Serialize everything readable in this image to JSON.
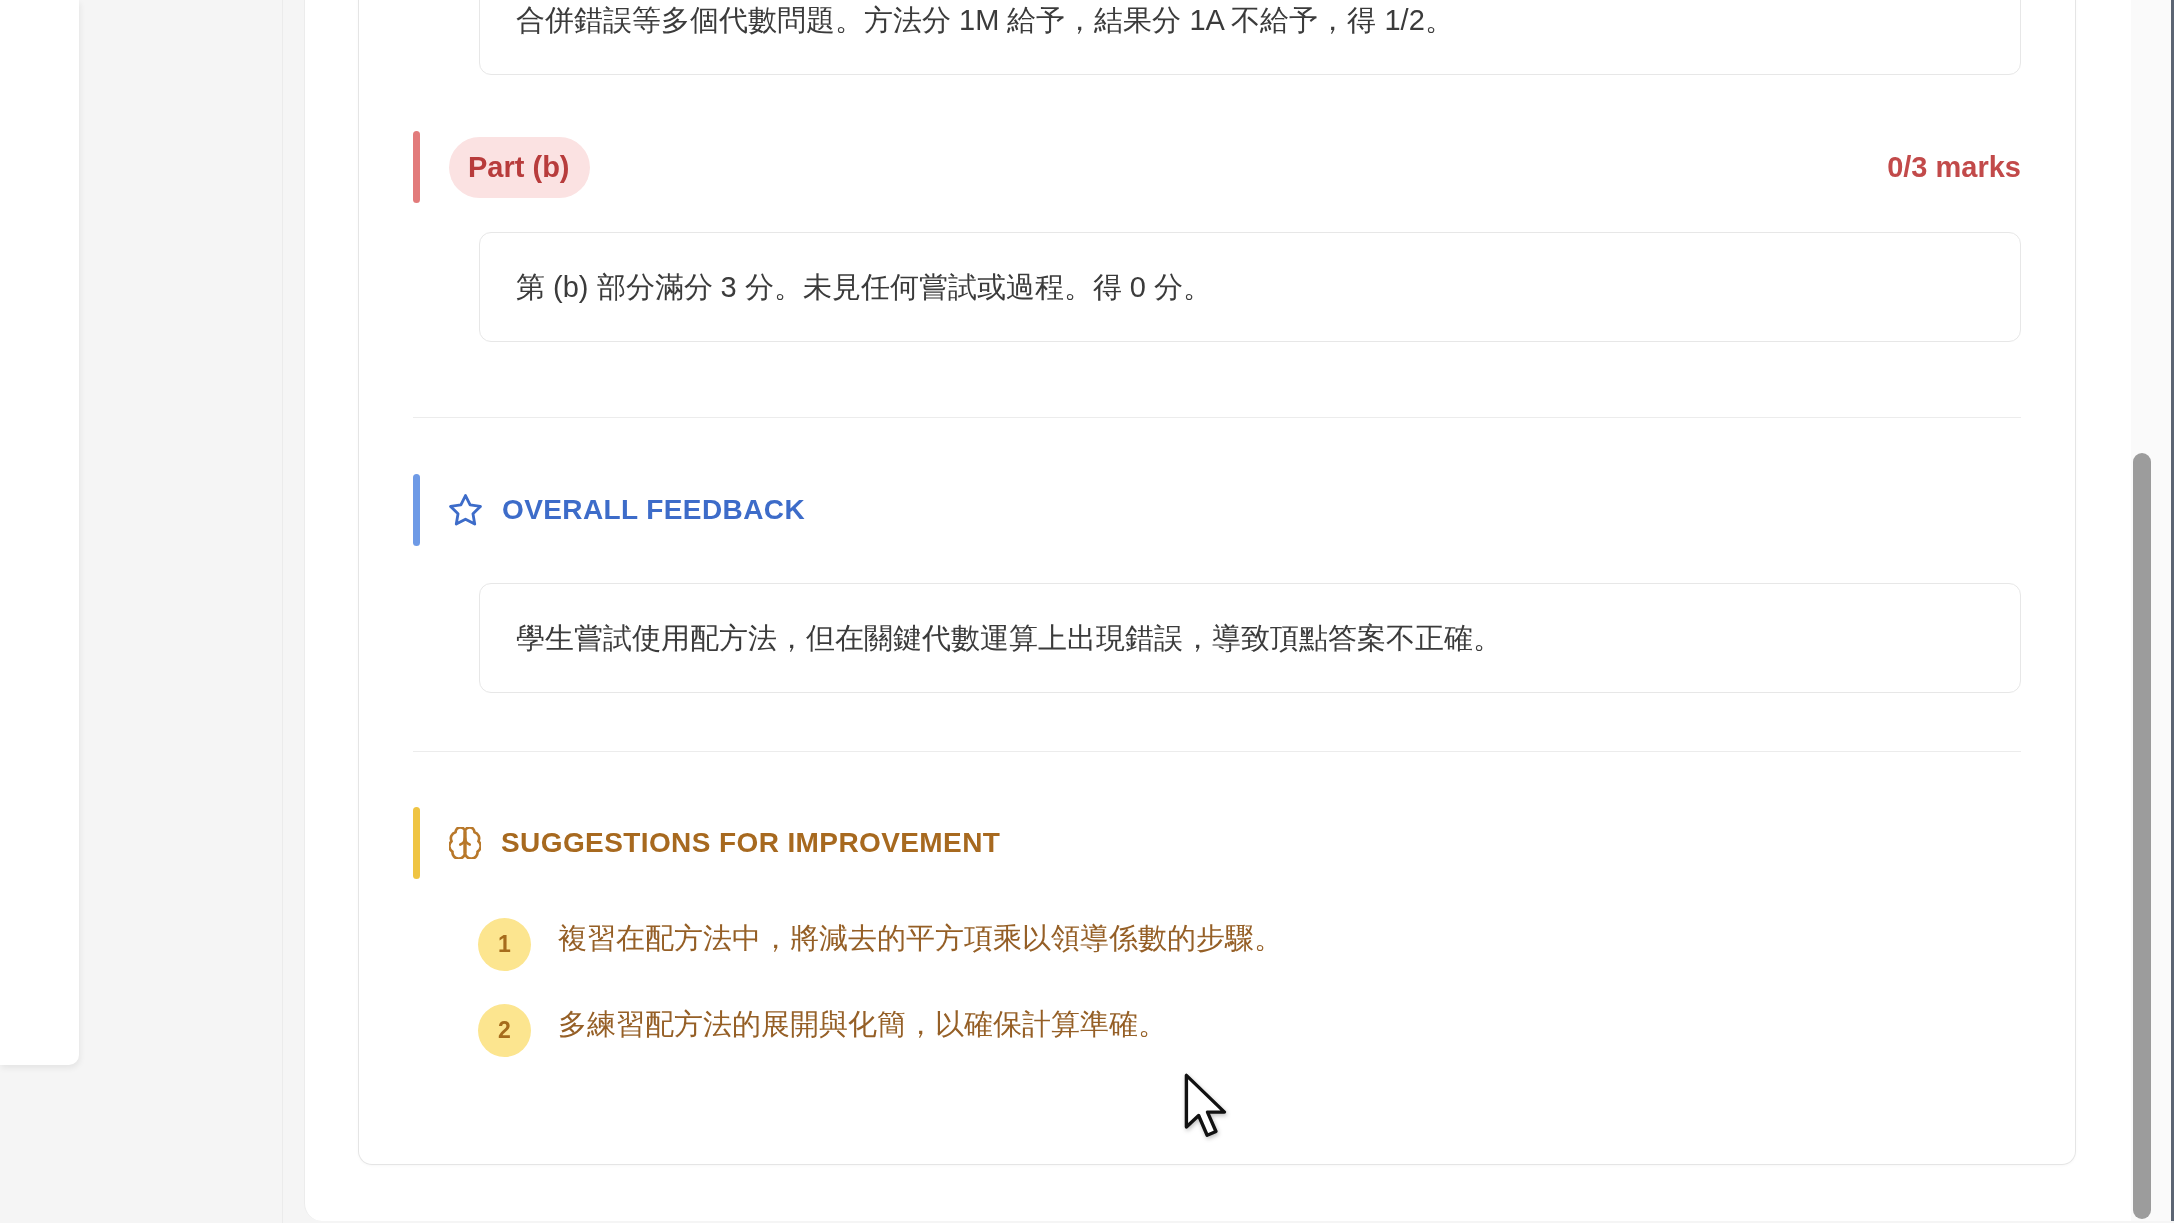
{
  "sections": [
    {
      "kind": "part",
      "comment": "合併錯誤等多個代數問題。方法分 1M 給予，結果分 1A 不給予，得 1/2。"
    },
    {
      "kind": "part",
      "label": "Part (b)",
      "score": "0/3 marks",
      "comment": "第 (b) 部分滿分 3 分。未見任何嘗試或過程。得 0 分。"
    },
    {
      "kind": "overall",
      "title": "OVERALL FEEDBACK",
      "text": "學生嘗試使用配方法，但在關鍵代數運算上出現錯誤，導致頂點答案不正確。"
    },
    {
      "kind": "suggestions",
      "title": "SUGGESTIONS FOR IMPROVEMENT",
      "items": [
        {
          "number": "1",
          "text": "複習在配方法中，將減去的平方項乘以領導係數的步驟。"
        },
        {
          "number": "2",
          "text": "多練習配方法的展開與化簡，以確保計算準確。"
        }
      ]
    }
  ]
}
